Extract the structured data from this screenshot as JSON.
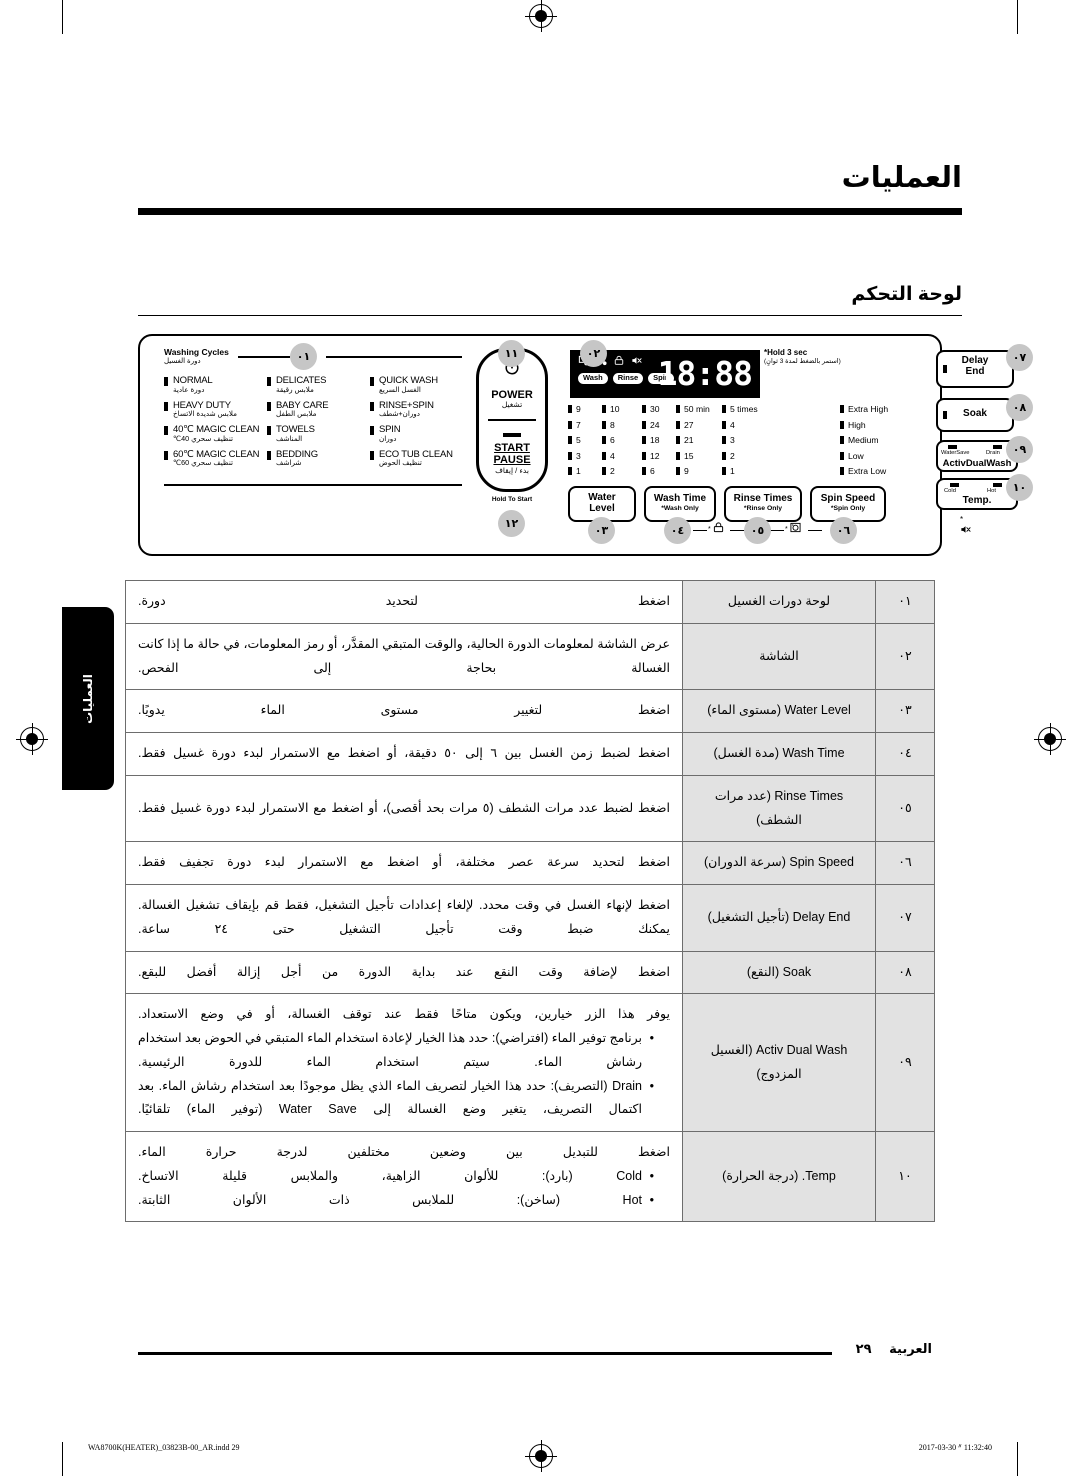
{
  "page": {
    "title": "العمليات",
    "section_title": "لوحة التحكم",
    "side_tab": "العمليات",
    "footer_language": "العربية",
    "footer_page": "٢٩",
    "print_left": "WA8700K(HEATER)_03823B-00_AR.indd   29",
    "print_right": "2017-03-30   ᐥ 11:32:40"
  },
  "panel": {
    "cycles_header_en": "Washing Cycles",
    "cycles_header_ar": "دورة الغسيل",
    "cycles": [
      {
        "en": "NORMAL",
        "ar": "دورة عادية"
      },
      {
        "en": "DELICATES",
        "ar": "ملابس رقيقة"
      },
      {
        "en": "QUICK WASH",
        "ar": "الغسل السريع"
      },
      {
        "en": "HEAVY DUTY",
        "ar": "ملابس شديدة الاتساخ"
      },
      {
        "en": "BABY CARE",
        "ar": "ملابس الطفل"
      },
      {
        "en": "RINSE+SPIN",
        "ar": "دوران+شطف"
      },
      {
        "en": "40℃ MAGIC CLEAN",
        "ar": "تنظيف سحري 40℃"
      },
      {
        "en": "TOWELS",
        "ar": "المناشف"
      },
      {
        "en": "SPIN",
        "ar": "دوران"
      },
      {
        "en": "60℃ MAGIC CLEAN",
        "ar": "تنظيف سحري 60℃"
      },
      {
        "en": "BEDDING",
        "ar": "شراشف"
      },
      {
        "en": "ECO TUB CLEAN",
        "ar": "تنظيف الحوض"
      }
    ],
    "power": {
      "en": "POWER",
      "ar": "تشغيل"
    },
    "start_pause": {
      "line1": "START",
      "line2": "PAUSE",
      "ar": "بدء / إيقاف"
    },
    "hold_to_start": "Hold To Start",
    "display": {
      "tags": [
        "Wash",
        "Rinse",
        "Spin"
      ],
      "segments": "18:88",
      "hold_note_en": "Hold 3 sec",
      "hold_note_ar": "(استمر بالضغط لمدة 3 ثوانٍ)"
    },
    "matrix": {
      "water_level_a": [
        "9",
        "7",
        "5",
        "3",
        "1"
      ],
      "water_level_b": [
        "10",
        "8",
        "6",
        "4",
        "2"
      ],
      "wash_time_a": [
        "30",
        "24",
        "18",
        "12",
        "6"
      ],
      "wash_time_b": [
        "50 min",
        "27",
        "21",
        "15",
        "9"
      ],
      "rinse_times": [
        "5 times",
        "4",
        "3",
        "2",
        "1"
      ],
      "spin_speed": [
        "Extra High",
        "High",
        "Medium",
        "Low",
        "Extra Low"
      ]
    },
    "buttons": {
      "water_level": {
        "l1": "Water",
        "l2": "Level"
      },
      "wash_time": {
        "l1": "Wash Time",
        "sub": "*Wash Only"
      },
      "rinse_times": {
        "l1": "Rinse Times",
        "sub": "*Rinse Only"
      },
      "spin_speed": {
        "l1": "Spin Speed",
        "sub": "*Spin Only"
      },
      "delay_end": {
        "l1": "Delay",
        "l2": "End"
      },
      "soak": {
        "l1": "Soak"
      },
      "activ_dual_wash": {
        "led1": "WaterSave",
        "led2": "Drain",
        "l1": "ActivDualWash"
      },
      "temp": {
        "led1": "Cold",
        "led2": "Hot",
        "l1": "Temp.",
        "sub": "*"
      }
    },
    "callouts": [
      "٠١",
      "٠٢",
      "٠٣",
      "٠٤",
      "٠٥",
      "٠٦",
      "٠٧",
      "٠٨",
      "٠٩",
      "١٠",
      "١١",
      "١٢"
    ]
  },
  "table": {
    "rows": [
      {
        "num": "٠١",
        "label": "لوحة دورات الغسيل",
        "lines": [
          "اضغط لتحديد دورة."
        ]
      },
      {
        "num": "٠٢",
        "label": "الشاشة",
        "lines": [
          "عرض الشاشة لمعلومات الدورة الحالية، والوقت المتبقي المقدَّر، أو رمز المعلومات، في حالة ما إذا كانت الغسالة بحاجة إلى الفحص."
        ]
      },
      {
        "num": "٠٣",
        "label": "Water Level (مستوى الماء)",
        "lines": [
          "اضغط لتغيير مستوى الماء يدويًا."
        ]
      },
      {
        "num": "٠٤",
        "label": "Wash Time (مدة الغسل)",
        "lines": [
          "اضغط لضبط زمن الغسل بين ٦ إلى ٥٠ دقيقة، أو اضغط مع الاستمرار لبدء دورة غسيل فقط."
        ]
      },
      {
        "num": "٠٥",
        "label": "Rinse Times (عدد مرات الشطف)",
        "lines": [
          "اضغط لضبط عدد مرات الشطف (٥ مرات بحد أقصى)، أو اضغط مع الاستمرار لبدء دورة غسيل فقط."
        ]
      },
      {
        "num": "٠٦",
        "label": "Spin Speed (سرعة الدوران)",
        "lines": [
          "اضغط لتحديد سرعة عصر مختلفة، أو اضغط مع الاستمرار لبدء دورة تجفيف فقط."
        ]
      },
      {
        "num": "٠٧",
        "label": "Delay End (تأجيل التشغيل)",
        "lines": [
          "اضغط لإنهاء الغسل في وقت محدد. لإلغاء إعدادات تأجيل التشغيل، فقط قم بإيقاف تشغيل الغسالة. يمكنك ضبط وقت تأجيل التشغيل حتى ٢٤ ساعة."
        ]
      },
      {
        "num": "٠٨",
        "label": "Soak (النقع)",
        "lines": [
          "اضغط لإضافة وقت النقع عند بداية الدورة من أجل إزالة أفضل للبقع."
        ]
      },
      {
        "num": "٠٩",
        "label": "Activ Dual Wash (الغسيل المزدوج)",
        "intro": "يوفر هذا الزر خيارين، ويكون متاحًا فقط عند توقف الغسالة، أو في وضع الاستعداد.",
        "bullets": [
          "برنامج توفير الماء (افتراضي): حدد هذا الخيار لإعادة استخدام الماء المتبقي في الحوض بعد استخدام رشاش الماء. سيتم استخدام الماء للدورة الرئيسية.",
          "Drain (التصريف): حدد هذا الخيار لتصريف الماء الذي يظل موجودًا بعد استخدام رشاش الماء. بعد اكتمال التصريف، يتغير وضع الغسالة إلى Water Save (توفير الماء) تلقائيًا."
        ]
      },
      {
        "num": "١٠",
        "label": "Temp. (درجة الحرارة)",
        "intro": "اضغط للتبديل بين وضعين مختلفين لدرجة حرارة الماء.",
        "bullets": [
          "Cold (بارد): للألوان الزاهية، والملابس قليلة الاتساخ.",
          "Hot (ساخن): للملابس ذات الألوان الثابتة."
        ]
      }
    ]
  }
}
